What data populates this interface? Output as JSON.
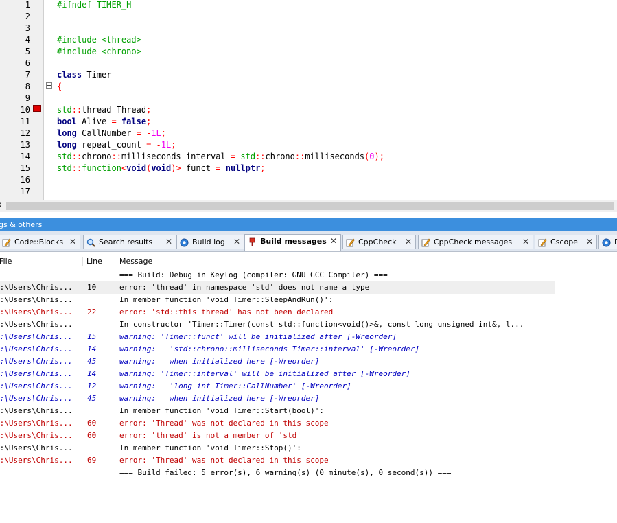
{
  "editor": {
    "line_numbers": [
      "1",
      "2",
      "3",
      "4",
      "5",
      "6",
      "7",
      "8",
      "9",
      "10",
      "11",
      "12",
      "13",
      "14",
      "15",
      "16",
      "17"
    ],
    "lines": {
      "l1": "#ifndef TIMER_H",
      "l4": "#include <thread>",
      "l5": "#include <chrono>",
      "l7_kw": "class",
      "l7_name": " Timer",
      "l8": "{",
      "l10a": "std",
      "l10b": "::",
      "l10c": "thread Thread",
      "l10d": ";",
      "l11a": "bool",
      "l11b": " Alive ",
      "l11c": "=",
      "l11d": " ",
      "l11e": "false",
      "l11f": ";",
      "l12a": "long",
      "l12b": " CallNumber ",
      "l12c": "=",
      "l12d": " ",
      "l12e": "-",
      "l12f": "1L",
      "l12g": ";",
      "l13a": "long",
      "l13b": " repeat_count ",
      "l13c": "=",
      "l13d": " ",
      "l13e": "-",
      "l13f": "1L",
      "l13g": ";",
      "l14a": "std",
      "l14b": "::",
      "l14c": "chrono",
      "l14d": "::",
      "l14e": "milliseconds interval ",
      "l14f": "=",
      "l14g": " ",
      "l14h": "std",
      "l14i": "::",
      "l14j": "chrono",
      "l14k": "::",
      "l14l": "milliseconds",
      "l14m": "(",
      "l14n": "0",
      "l14o": ");",
      "l15a": "std",
      "l15b": "::",
      "l15c": "function",
      "l15d": "<",
      "l15e": "void",
      "l15f": "(",
      "l15g": "void",
      "l15h": ")>",
      "l15i": " funct ",
      "l15j": "=",
      "l15k": " ",
      "l15l": "nullptr",
      "l15m": ";"
    }
  },
  "scrollbar_corner": "x",
  "logs_panel": {
    "title": "gs & others",
    "tabs": [
      {
        "label": "Code::Blocks",
        "icon": "edit-note-icon"
      },
      {
        "label": "Search results",
        "icon": "magnifier-icon"
      },
      {
        "label": "Build log",
        "icon": "gear-icon"
      },
      {
        "label": "Build messages",
        "icon": "build-pin-icon",
        "active": true
      },
      {
        "label": "CppCheck",
        "icon": "edit-note-icon"
      },
      {
        "label": "CppCheck messages",
        "icon": "edit-note-icon"
      },
      {
        "label": "Cscope",
        "icon": "edit-note-icon"
      },
      {
        "label": "D",
        "icon": "gear-icon"
      }
    ],
    "close_glyph": "✕",
    "columns": {
      "file": "File",
      "line": "Line",
      "message": "Message"
    },
    "rows": [
      {
        "file": "",
        "line": "",
        "message": "=== Build: Debug in Keylog (compiler: GNU GCC Compiler) ===",
        "type": "info"
      },
      {
        "file": "C:\\Users\\Chris...",
        "line": "10",
        "message": "error: 'thread' in namespace 'std' does not name a type",
        "type": "info",
        "selected": true
      },
      {
        "file": "C:\\Users\\Chris...",
        "line": "",
        "message": "In member function 'void Timer::SleepAndRun()':",
        "type": "info"
      },
      {
        "file": "C:\\Users\\Chris...",
        "line": "22",
        "message": "error: 'std::this_thread' has not been declared",
        "type": "err"
      },
      {
        "file": "C:\\Users\\Chris...",
        "line": "",
        "message": "In constructor 'Timer::Timer(const std::function<void()>&, const long unsigned int&, l...",
        "type": "info"
      },
      {
        "file": "C:\\Users\\Chris...",
        "line": "15",
        "message": "warning: 'Timer::funct' will be initialized after [-Wreorder]",
        "type": "warn"
      },
      {
        "file": "C:\\Users\\Chris...",
        "line": "14",
        "message": "warning:   'std::chrono::milliseconds Timer::interval' [-Wreorder]",
        "type": "warn"
      },
      {
        "file": "C:\\Users\\Chris...",
        "line": "45",
        "message": "warning:   when initialized here [-Wreorder]",
        "type": "warn"
      },
      {
        "file": "C:\\Users\\Chris...",
        "line": "14",
        "message": "warning: 'Timer::interval' will be initialized after [-Wreorder]",
        "type": "warn"
      },
      {
        "file": "C:\\Users\\Chris...",
        "line": "12",
        "message": "warning:   'long int Timer::CallNumber' [-Wreorder]",
        "type": "warn"
      },
      {
        "file": "C:\\Users\\Chris...",
        "line": "45",
        "message": "warning:   when initialized here [-Wreorder]",
        "type": "warn"
      },
      {
        "file": "C:\\Users\\Chris...",
        "line": "",
        "message": "In member function 'void Timer::Start(bool)':",
        "type": "info"
      },
      {
        "file": "C:\\Users\\Chris...",
        "line": "60",
        "message": "error: 'Thread' was not declared in this scope",
        "type": "err"
      },
      {
        "file": "C:\\Users\\Chris...",
        "line": "60",
        "message": "error: 'thread' is not a member of 'std'",
        "type": "err"
      },
      {
        "file": "C:\\Users\\Chris...",
        "line": "",
        "message": "In member function 'void Timer::Stop()':",
        "type": "info"
      },
      {
        "file": "C:\\Users\\Chris...",
        "line": "69",
        "message": "error: 'Thread' was not declared in this scope",
        "type": "err"
      },
      {
        "file": "",
        "line": "",
        "message": "=== Build failed: 5 error(s), 6 warning(s) (0 minute(s), 0 second(s)) ===",
        "type": "info"
      }
    ]
  },
  "colors": {
    "panel_title_bg": "#3c8fde",
    "error_text": "#c00000",
    "warning_text": "#0000c0",
    "breakpoint": "#e00000",
    "preprocessor": "#00a000",
    "keyword": "#00007f",
    "number": "#f000f0"
  }
}
